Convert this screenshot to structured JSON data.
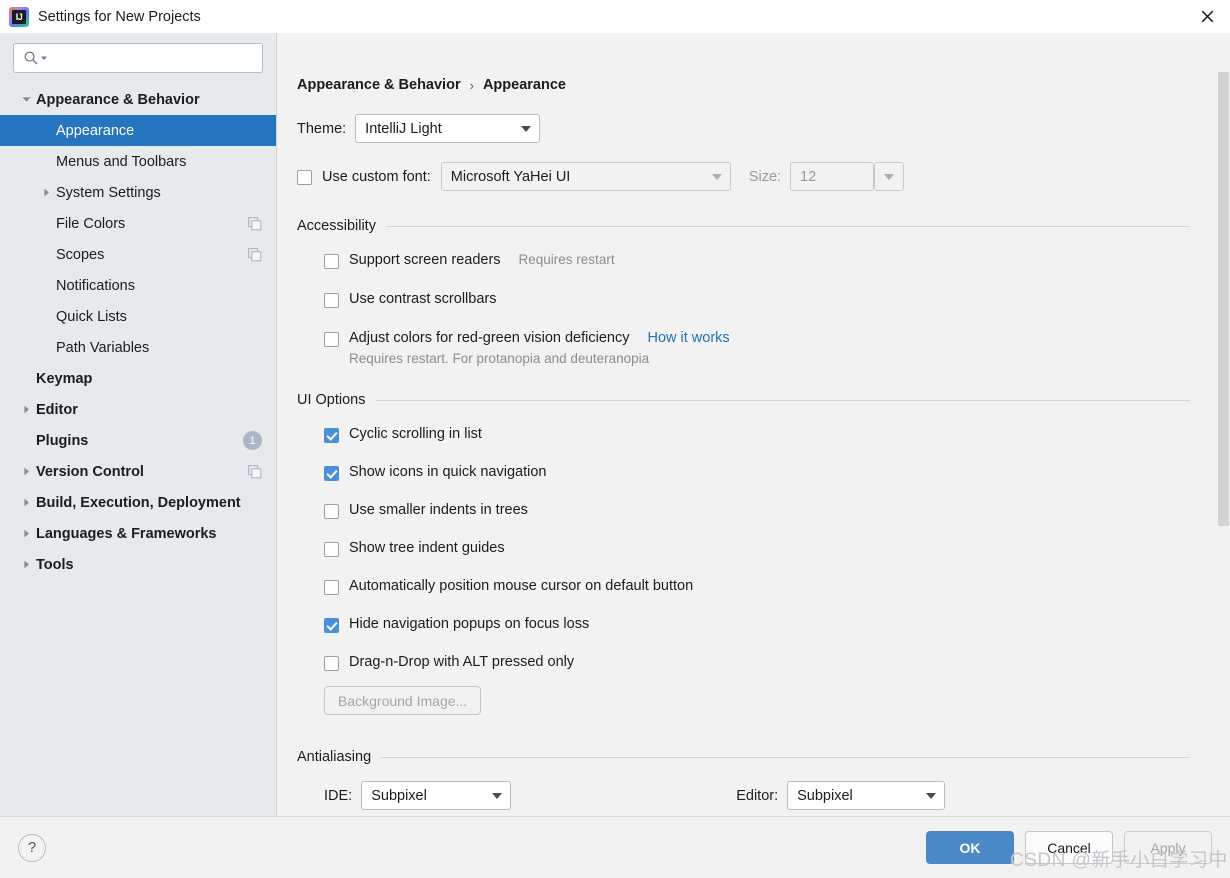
{
  "window": {
    "title": "Settings for New Projects",
    "logo_icon": "intellij-idea-logo",
    "close_icon": "close-icon"
  },
  "sidebar": {
    "search": {
      "placeholder": "",
      "value": "",
      "icon": "search-icon",
      "dropdown_icon": "chevron-down-icon"
    },
    "items": [
      {
        "label": "Appearance & Behavior",
        "level": 0,
        "bold": true,
        "twisty": "expanded",
        "selected": false,
        "badge": null,
        "trailing_icon": null
      },
      {
        "label": "Appearance",
        "level": 1,
        "bold": false,
        "twisty": "none",
        "selected": true,
        "badge": null,
        "trailing_icon": null
      },
      {
        "label": "Menus and Toolbars",
        "level": 1,
        "bold": false,
        "twisty": "none",
        "selected": false,
        "badge": null,
        "trailing_icon": null
      },
      {
        "label": "System Settings",
        "level": 1,
        "bold": false,
        "twisty": "collapsed",
        "selected": false,
        "badge": null,
        "trailing_icon": null
      },
      {
        "label": "File Colors",
        "level": 1,
        "bold": false,
        "twisty": "none",
        "selected": false,
        "badge": null,
        "trailing_icon": "copy-icon"
      },
      {
        "label": "Scopes",
        "level": 1,
        "bold": false,
        "twisty": "none",
        "selected": false,
        "badge": null,
        "trailing_icon": "copy-icon"
      },
      {
        "label": "Notifications",
        "level": 1,
        "bold": false,
        "twisty": "none",
        "selected": false,
        "badge": null,
        "trailing_icon": null
      },
      {
        "label": "Quick Lists",
        "level": 1,
        "bold": false,
        "twisty": "none",
        "selected": false,
        "badge": null,
        "trailing_icon": null
      },
      {
        "label": "Path Variables",
        "level": 1,
        "bold": false,
        "twisty": "none",
        "selected": false,
        "badge": null,
        "trailing_icon": null
      },
      {
        "label": "Keymap",
        "level": 0,
        "bold": true,
        "twisty": "none",
        "selected": false,
        "badge": null,
        "trailing_icon": null
      },
      {
        "label": "Editor",
        "level": 0,
        "bold": true,
        "twisty": "collapsed",
        "selected": false,
        "badge": null,
        "trailing_icon": null
      },
      {
        "label": "Plugins",
        "level": 0,
        "bold": true,
        "twisty": "none",
        "selected": false,
        "badge": "1",
        "trailing_icon": null
      },
      {
        "label": "Version Control",
        "level": 0,
        "bold": true,
        "twisty": "collapsed",
        "selected": false,
        "badge": null,
        "trailing_icon": "copy-icon"
      },
      {
        "label": "Build, Execution, Deployment",
        "level": 0,
        "bold": true,
        "twisty": "collapsed",
        "selected": false,
        "badge": null,
        "trailing_icon": null
      },
      {
        "label": "Languages & Frameworks",
        "level": 0,
        "bold": true,
        "twisty": "collapsed",
        "selected": false,
        "badge": null,
        "trailing_icon": null
      },
      {
        "label": "Tools",
        "level": 0,
        "bold": true,
        "twisty": "collapsed",
        "selected": false,
        "badge": null,
        "trailing_icon": null
      }
    ]
  },
  "main": {
    "breadcrumb": {
      "parent": "Appearance & Behavior",
      "separator": "›",
      "current": "Appearance"
    },
    "theme": {
      "label": "Theme:",
      "value": "IntelliJ Light"
    },
    "custom_font": {
      "checkbox_label": "Use custom font:",
      "checked": false,
      "font_value": "Microsoft YaHei UI",
      "font_disabled": true,
      "size_label": "Size:",
      "size_value": "12",
      "size_disabled": true
    },
    "accessibility": {
      "title": "Accessibility",
      "options": [
        {
          "label": "Support screen readers",
          "checked": false,
          "hint": "Requires restart",
          "link": null,
          "sub": null
        },
        {
          "label": "Use contrast scrollbars",
          "checked": false,
          "hint": null,
          "link": null,
          "sub": null
        },
        {
          "label": "Adjust colors for red-green vision deficiency",
          "checked": false,
          "hint": null,
          "link": "How it works",
          "sub": "Requires restart. For protanopia and deuteranopia"
        }
      ]
    },
    "ui_options": {
      "title": "UI Options",
      "options": [
        {
          "label": "Cyclic scrolling in list",
          "checked": true
        },
        {
          "label": "Show icons in quick navigation",
          "checked": true
        },
        {
          "label": "Use smaller indents in trees",
          "checked": false
        },
        {
          "label": "Show tree indent guides",
          "checked": false
        },
        {
          "label": "Automatically position mouse cursor on default button",
          "checked": false
        },
        {
          "label": "Hide navigation popups on focus loss",
          "checked": true
        },
        {
          "label": "Drag-n-Drop with ALT pressed only",
          "checked": false
        }
      ],
      "background_image_button": "Background Image...",
      "background_image_disabled": true
    },
    "antialiasing": {
      "title": "Antialiasing",
      "ide_label": "IDE:",
      "ide_value": "Subpixel",
      "editor_label": "Editor:",
      "editor_value": "Subpixel"
    },
    "scrollbar": {
      "thumb_top_pct": 5,
      "thumb_height_pct": 58
    }
  },
  "footer": {
    "help_icon": "question-mark-icon",
    "help_label": "?",
    "ok": "OK",
    "cancel": "Cancel",
    "apply": "Apply",
    "apply_disabled": true
  },
  "watermark": {
    "text": "CSDN @新手小白学习中"
  },
  "colors": {
    "accent": "#4a88c7",
    "selection": "#2675bf",
    "checkbox_checked": "#4a90d9",
    "link": "#2470b3",
    "sidebar_bg": "#e6eaed",
    "panel_bg": "#f2f2f2"
  }
}
